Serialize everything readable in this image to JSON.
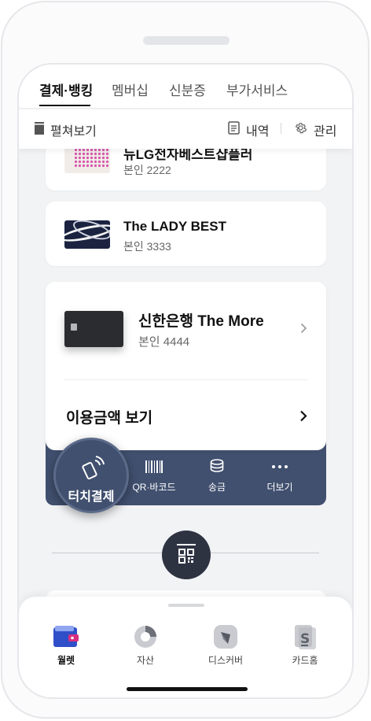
{
  "tabs": [
    {
      "label": "결제·뱅킹",
      "active": true
    },
    {
      "label": "멤버십"
    },
    {
      "label": "신분증"
    },
    {
      "label": "부가서비스"
    }
  ],
  "toolbar": {
    "expand_label": "펼쳐보기",
    "history_label": "내역",
    "manage_label": "관리"
  },
  "cards": [
    {
      "name": "뉴LG전자베스트샵플러",
      "owner": "본인 2222"
    },
    {
      "name": "The LADY BEST",
      "owner": "본인 3333"
    }
  ],
  "selected_card": {
    "name": "신한은행 The More",
    "owner": "본인 4444",
    "usage_label": "이용금액 보기"
  },
  "actions": {
    "touch_pay": "터치결제",
    "qr_barcode": "QR·바코드",
    "transfer": "송금",
    "more": "더보기"
  },
  "bottom_nav": [
    {
      "label": "월렛",
      "icon": "wallet-icon",
      "active": true
    },
    {
      "label": "자산",
      "icon": "pie-chart-icon"
    },
    {
      "label": "디스커버",
      "icon": "compass-icon"
    },
    {
      "label": "카드홈",
      "icon": "card-home-icon"
    }
  ],
  "colors": {
    "action_bar": "#41506f",
    "qr_button": "#2e3342",
    "wallet_accent": "#3a5bd9"
  }
}
